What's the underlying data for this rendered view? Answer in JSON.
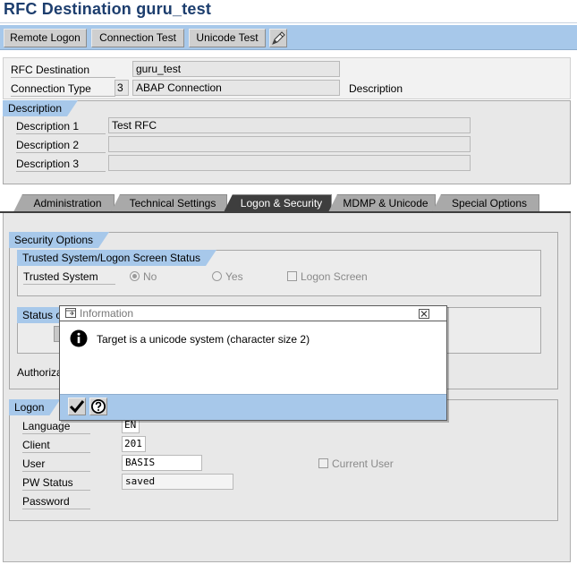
{
  "header": {
    "title": "RFC Destination guru_test"
  },
  "toolbar": {
    "remote_logon": "Remote Logon",
    "connection_test": "Connection Test",
    "unicode_test": "Unicode Test",
    "extra_icon": "edit-pencil-icon"
  },
  "destination": {
    "rfc_label": "RFC Destination",
    "rfc_value": "guru_test",
    "type_label": "Connection Type",
    "type_code": "3",
    "type_value": "ABAP Connection",
    "description_label": "Description"
  },
  "description_group": {
    "title": "Description",
    "rows": [
      {
        "label": "Description 1",
        "value": "Test RFC"
      },
      {
        "label": "Description 2",
        "value": ""
      },
      {
        "label": "Description 3",
        "value": ""
      }
    ]
  },
  "tabs": [
    {
      "label": "Administration"
    },
    {
      "label": "Technical Settings"
    },
    {
      "label": "Logon & Security"
    },
    {
      "label": "MDMP & Unicode"
    },
    {
      "label": "Special Options"
    }
  ],
  "security": {
    "title": "Security Options",
    "trusted_title": "Trusted System/Logon Screen Status",
    "trusted_label": "Trusted System",
    "no_label": "No",
    "yes_label": "Yes",
    "logon_screen_label": "Logon Screen",
    "status_title": "Status o",
    "authoriz_label": "Authoriza"
  },
  "logon": {
    "title": "Logon",
    "language_label": "Language",
    "language_value": "EN",
    "client_label": "Client",
    "client_value": "201",
    "user_label": "User",
    "user_value": "BASIS",
    "current_user_label": "Current User",
    "pw_status_label": "PW Status",
    "pw_status_value": "saved",
    "password_label": "Password"
  },
  "dialog": {
    "title": "Information",
    "message": "Target is a unicode system (character size 2)"
  },
  "colors": {
    "accent": "#a7c8ea",
    "title": "#1d3e6e",
    "active_tab": "#3e3e3e"
  }
}
